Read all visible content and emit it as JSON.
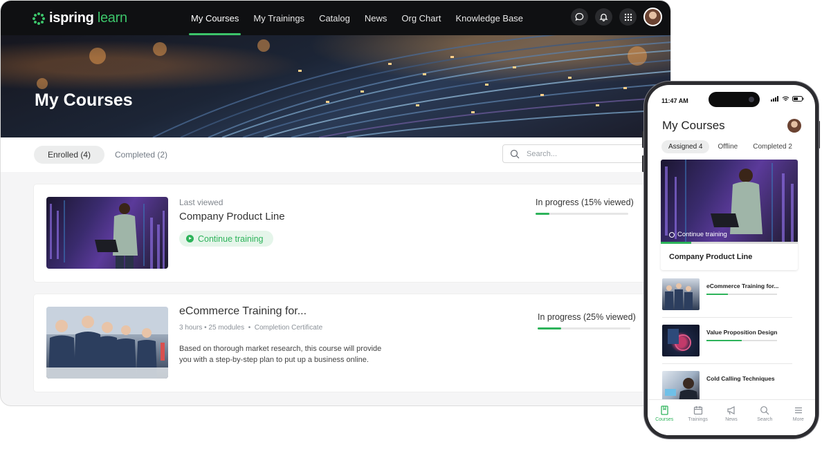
{
  "brand": {
    "name_bold": "ispring",
    "name_light": "learn",
    "accent": "#3cc46a"
  },
  "nav": {
    "items": [
      {
        "label": "My Courses",
        "active": true
      },
      {
        "label": "My Trainings",
        "active": false
      },
      {
        "label": "Catalog",
        "active": false
      },
      {
        "label": "News",
        "active": false
      },
      {
        "label": "Org Chart",
        "active": false
      },
      {
        "label": "Knowledge Base",
        "active": false
      }
    ],
    "icons": [
      "chat-icon",
      "bell-icon",
      "apps-grid-icon",
      "user-avatar"
    ]
  },
  "hero": {
    "title": "My Courses"
  },
  "filters": {
    "enrolled": "Enrolled (4)",
    "completed": "Completed (2)",
    "search_placeholder": "Search..."
  },
  "courses": [
    {
      "last_viewed": "Last viewed",
      "title": "Company Product Line",
      "cta": "Continue training",
      "status": "In progress (15% viewed)",
      "progress": 0.15
    },
    {
      "title": "eCommerce Training for...",
      "meta_left": "3 hours • 25 modules",
      "meta_sep": "•",
      "meta_right": "Completion Certificate",
      "description": "Based on thorough market research, this course will provide you with a step-by-step plan to put up a business online.",
      "status": "In progress (25% viewed)",
      "progress": 0.25
    }
  ],
  "phone": {
    "time": "11:47 AM",
    "title": "My Courses",
    "tabs": [
      {
        "label": "Assigned 4",
        "active": true
      },
      {
        "label": "Offline",
        "active": false
      },
      {
        "label": "Completed 2",
        "active": false
      }
    ],
    "featured": {
      "cta": "Continue training",
      "title": "Company Product Line",
      "progress": 0.22
    },
    "items": [
      {
        "title": "eCommerce Training for...",
        "progress": 0.3
      },
      {
        "title": "Value Proposition Design",
        "progress": 0.5
      },
      {
        "title": "Cold Calling Techniques"
      }
    ],
    "bottom_nav": [
      {
        "label": "Courses",
        "icon": "book-icon",
        "active": true
      },
      {
        "label": "Trainings",
        "icon": "calendar-icon",
        "active": false
      },
      {
        "label": "News",
        "icon": "megaphone-icon",
        "active": false
      },
      {
        "label": "Search",
        "icon": "search-icon",
        "active": false
      },
      {
        "label": "More",
        "icon": "menu-icon",
        "active": false
      }
    ]
  }
}
